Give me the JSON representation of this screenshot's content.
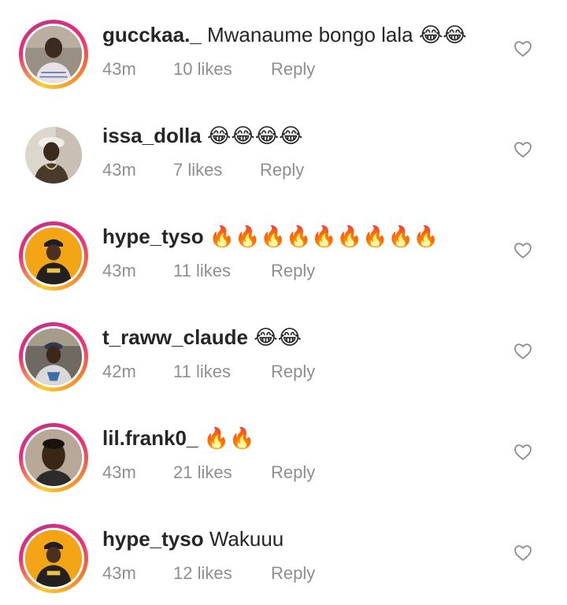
{
  "comments": [
    {
      "username": "gucckaa._",
      "text": "Mwanaume bongo lala 😂😂",
      "time": "43m",
      "likes": "10 likes",
      "reply": "Reply",
      "story_ring": true,
      "avatar_icon": "avatar-photo"
    },
    {
      "username": "issa_dolla",
      "text": "😂😂😂😂",
      "time": "43m",
      "likes": "7 likes",
      "reply": "Reply",
      "story_ring": false,
      "avatar_icon": "avatar-photo"
    },
    {
      "username": "hype_tyso",
      "text": "🔥🔥🔥🔥🔥🔥🔥🔥🔥",
      "time": "43m",
      "likes": "11 likes",
      "reply": "Reply",
      "story_ring": true,
      "avatar_icon": "avatar-photo"
    },
    {
      "username": "t_raww_claude",
      "text": "😂😂",
      "time": "42m",
      "likes": "11 likes",
      "reply": "Reply",
      "story_ring": true,
      "avatar_icon": "avatar-photo"
    },
    {
      "username": "lil.frank0_",
      "text": "🔥🔥",
      "time": "43m",
      "likes": "21 likes",
      "reply": "Reply",
      "story_ring": true,
      "avatar_icon": "avatar-photo"
    },
    {
      "username": "hype_tyso",
      "text": "Wakuuu",
      "time": "43m",
      "likes": "12 likes",
      "reply": "Reply",
      "story_ring": true,
      "avatar_icon": "avatar-photo"
    }
  ],
  "colors": {
    "text": "#262626",
    "meta": "#8e8e8e",
    "story_ring_start": "#f9ce34",
    "story_ring_mid": "#ee2a7b",
    "heart_outline": "#8e8e8e"
  },
  "icons": {
    "like": "heart-outline-icon"
  }
}
